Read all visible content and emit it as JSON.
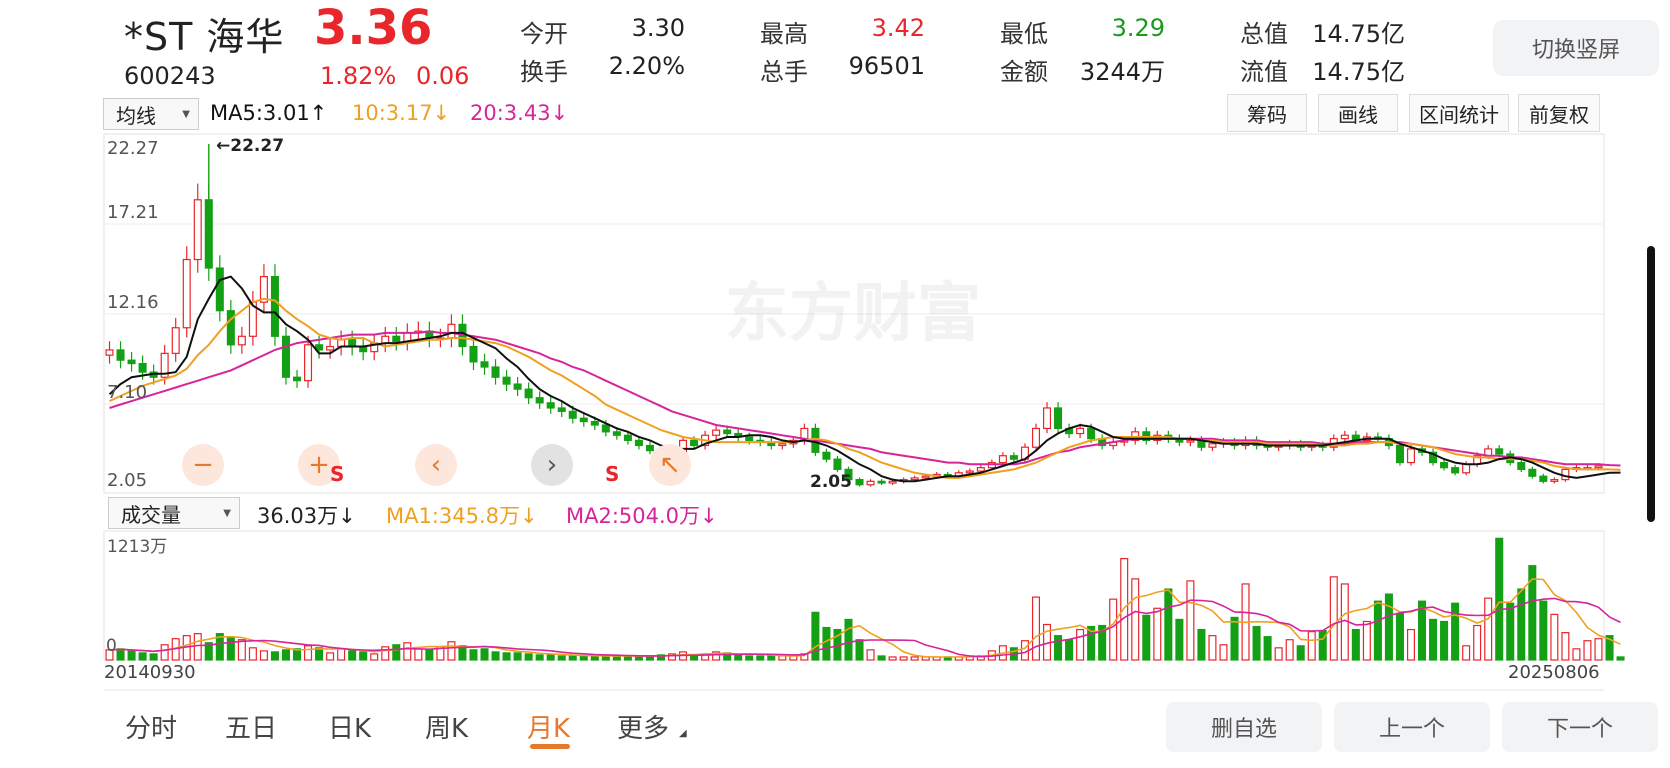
{
  "header": {
    "name": "*ST 海华",
    "price": "3.36",
    "code": "600243",
    "change_pct": "1.82%",
    "change": "0.06",
    "quotes": [
      {
        "label": "今开",
        "value": "3.30",
        "color": "#222"
      },
      {
        "label": "最高",
        "value": "3.42",
        "color": "#e8262b"
      },
      {
        "label": "最低",
        "value": "3.29",
        "color": "#1a9a1a"
      },
      {
        "label": "总值",
        "value": "14.75亿",
        "color": "#222"
      },
      {
        "label": "换手",
        "value": "2.20%",
        "color": "#222"
      },
      {
        "label": "总手",
        "value": "96501",
        "color": "#222"
      },
      {
        "label": "金额",
        "value": "3244万",
        "color": "#222"
      },
      {
        "label": "流值",
        "value": "14.75亿",
        "color": "#222"
      }
    ],
    "rotate_button": "切换竖屏"
  },
  "indicator_bar": {
    "select": "均线",
    "ma5": "MA5:3.01↑",
    "ma10": "10:3.17↓",
    "ma20": "20:3.43↓",
    "tools": [
      "筹码",
      "画线",
      "区间统计",
      "前复权"
    ],
    "colors": {
      "ma5": "#111111",
      "ma10": "#f0a020",
      "ma20": "#d6249a"
    }
  },
  "volume_bar": {
    "select": "成交量",
    "current": "36.03万↓",
    "ma1": "MA1:345.8万↓",
    "ma2": "MA2:504.0万↓",
    "ytop": "1213万",
    "ybottom": "0"
  },
  "watermark": "东方财富",
  "chart_data": {
    "type": "candlestick",
    "period": "monthly",
    "y_ticks": [
      "22.27",
      "17.21",
      "12.16",
      "7.10",
      "2.05"
    ],
    "ylim": [
      2.05,
      22.27
    ],
    "max_marker": "←22.27",
    "min_marker": "2.05",
    "x_start": "20140930",
    "x_end": "20250806",
    "close": [
      10.2,
      9.6,
      9.4,
      8.9,
      8.6,
      10.0,
      11.5,
      15.5,
      19.0,
      15.0,
      12.5,
      10.5,
      11.0,
      13.0,
      14.5,
      11.0,
      8.6,
      8.4,
      10.5,
      10.2,
      10.4,
      10.8,
      10.4,
      10.1,
      10.6,
      11.0,
      10.7,
      11.2,
      11.3,
      10.9,
      10.9,
      11.7,
      10.4,
      9.5,
      9.2,
      8.6,
      8.2,
      7.9,
      7.4,
      7.1,
      6.8,
      6.6,
      6.2,
      6.0,
      5.8,
      5.4,
      5.2,
      4.9,
      4.6,
      4.3,
      3.9,
      4.2,
      4.9,
      4.6,
      5.2,
      5.5,
      5.3,
      5.1,
      4.9,
      4.8,
      4.6,
      4.7,
      4.9,
      5.6,
      4.2,
      3.8,
      3.2,
      2.6,
      2.3,
      2.5,
      2.4,
      2.5,
      2.6,
      2.7,
      2.8,
      2.9,
      2.8,
      3.0,
      3.1,
      3.3,
      3.6,
      4.0,
      3.8,
      4.5,
      5.6,
      6.8,
      5.6,
      5.3,
      5.6,
      5.0,
      4.6,
      4.8,
      4.9,
      5.4,
      4.9,
      5.2,
      5.0,
      4.8,
      4.9,
      4.5,
      4.7,
      4.8,
      4.6,
      4.9,
      4.6,
      4.5,
      4.6,
      4.7,
      4.5,
      4.6,
      4.5,
      5.0,
      5.2,
      4.9,
      5.1,
      5.0,
      4.6,
      3.6,
      4.4,
      4.2,
      3.6,
      3.3,
      3.0,
      3.5,
      4.0,
      4.4,
      4.1,
      3.6,
      3.2,
      2.8,
      2.5,
      2.6,
      3.2,
      3.3,
      3.3,
      3.4
    ],
    "ma5": [
      7.6,
      8.2,
      8.6,
      8.7,
      8.8,
      8.8,
      8.9,
      9.8,
      12.0,
      13.2,
      14.3,
      14.5,
      13.8,
      12.8,
      12.4,
      12.4,
      11.7,
      11.3,
      10.8,
      10.0,
      10.0,
      10.4,
      10.4,
      10.4,
      10.5,
      10.6,
      10.6,
      10.7,
      10.8,
      10.9,
      11.0,
      11.2,
      11.2,
      10.9,
      10.6,
      10.3,
      9.7,
      9.2,
      8.5,
      7.9,
      7.5,
      7.2,
      6.8,
      6.5,
      6.2,
      5.9,
      5.6,
      5.4,
      5.1,
      4.9,
      4.6,
      4.4,
      4.4,
      4.4,
      4.7,
      4.9,
      5.1,
      5.1,
      5.2,
      5.2,
      5.1,
      4.9,
      4.8,
      4.9,
      4.8,
      4.6,
      4.3,
      3.9,
      3.5,
      3.2,
      2.8,
      2.6,
      2.5,
      2.5,
      2.6,
      2.7,
      2.8,
      2.8,
      2.9,
      3.0,
      3.2,
      3.4,
      3.6,
      3.8,
      4.3,
      4.9,
      5.3,
      5.6,
      5.8,
      5.7,
      5.4,
      5.1,
      5.0,
      5.0,
      5.0,
      5.0,
      5.0,
      5.0,
      5.0,
      4.9,
      4.8,
      4.7,
      4.7,
      4.7,
      4.7,
      4.6,
      4.6,
      4.6,
      4.6,
      4.6,
      4.6,
      4.7,
      4.8,
      4.9,
      5.0,
      5.0,
      5.0,
      4.7,
      4.5,
      4.3,
      4.1,
      3.8,
      3.6,
      3.5,
      3.5,
      3.6,
      3.8,
      3.9,
      3.8,
      3.6,
      3.3,
      3.0,
      2.8,
      2.7,
      2.8,
      2.9,
      3.0,
      3.01
    ],
    "ma10": [
      7.2,
      7.5,
      7.8,
      8.1,
      8.3,
      8.5,
      8.7,
      9.1,
      9.9,
      10.5,
      11.3,
      12.0,
      12.5,
      13.0,
      13.2,
      13.1,
      12.5,
      12.0,
      11.6,
      11.1,
      10.9,
      10.8,
      10.9,
      10.9,
      10.6,
      10.4,
      10.5,
      10.6,
      10.7,
      10.8,
      10.8,
      10.9,
      10.9,
      10.8,
      10.7,
      10.6,
      10.4,
      10.1,
      9.8,
      9.4,
      9.0,
      8.7,
      8.3,
      7.9,
      7.5,
      7.0,
      6.7,
      6.4,
      6.1,
      5.8,
      5.5,
      5.3,
      5.1,
      5.0,
      4.9,
      4.8,
      4.8,
      4.8,
      4.8,
      4.8,
      4.8,
      4.8,
      4.8,
      4.9,
      5.0,
      4.9,
      4.7,
      4.4,
      4.2,
      3.9,
      3.6,
      3.4,
      3.2,
      3.0,
      2.9,
      2.8,
      2.7,
      2.7,
      2.8,
      2.9,
      3.0,
      3.1,
      3.2,
      3.4,
      3.6,
      3.9,
      4.2,
      4.5,
      4.7,
      4.9,
      5.0,
      5.1,
      5.1,
      5.1,
      5.1,
      5.1,
      5.1,
      5.0,
      5.0,
      4.9,
      4.9,
      4.8,
      4.8,
      4.8,
      4.8,
      4.7,
      4.7,
      4.7,
      4.7,
      4.7,
      4.6,
      4.6,
      4.6,
      4.7,
      4.7,
      4.8,
      4.8,
      4.7,
      4.7,
      4.6,
      4.5,
      4.3,
      4.1,
      4.0,
      3.9,
      3.9,
      3.8,
      3.8,
      3.8,
      3.7,
      3.6,
      3.4,
      3.3,
      3.2,
      3.2,
      3.2,
      3.2,
      3.17
    ],
    "ma20": [
      6.8,
      7.0,
      7.2,
      7.4,
      7.6,
      7.8,
      8.0,
      8.2,
      8.4,
      8.6,
      8.8,
      9.0,
      9.3,
      9.6,
      9.9,
      10.2,
      10.4,
      10.6,
      10.7,
      10.8,
      10.9,
      11.0,
      11.1,
      11.1,
      11.1,
      11.2,
      11.2,
      11.2,
      11.2,
      11.3,
      11.2,
      11.2,
      11.1,
      11.0,
      10.9,
      10.8,
      10.6,
      10.4,
      10.2,
      10.0,
      9.7,
      9.5,
      9.2,
      9.0,
      8.7,
      8.4,
      8.1,
      7.8,
      7.5,
      7.2,
      6.9,
      6.6,
      6.4,
      6.2,
      6.0,
      5.8,
      5.7,
      5.6,
      5.5,
      5.4,
      5.3,
      5.2,
      5.1,
      5.0,
      4.9,
      4.8,
      4.7,
      4.6,
      4.5,
      4.4,
      4.2,
      4.1,
      4.0,
      3.9,
      3.8,
      3.7,
      3.6,
      3.6,
      3.5,
      3.5,
      3.5,
      3.5,
      3.5,
      3.6,
      3.8,
      4.0,
      4.2,
      4.3,
      4.5,
      4.6,
      4.7,
      4.8,
      4.9,
      5.0,
      5.0,
      5.0,
      5.0,
      5.0,
      5.0,
      5.0,
      5.0,
      4.9,
      4.9,
      4.9,
      4.9,
      4.8,
      4.8,
      4.8,
      4.8,
      4.8,
      4.7,
      4.7,
      4.7,
      4.8,
      4.8,
      4.8,
      4.8,
      4.8,
      4.7,
      4.6,
      4.5,
      4.4,
      4.3,
      4.2,
      4.1,
      4.0,
      4.0,
      3.9,
      3.9,
      3.8,
      3.7,
      3.6,
      3.5,
      3.5,
      3.5,
      3.5,
      3.45,
      3.43
    ],
    "volume_wan": [
      100,
      110,
      90,
      70,
      60,
      150,
      210,
      240,
      260,
      170,
      260,
      220,
      200,
      120,
      90,
      80,
      100,
      110,
      140,
      120,
      70,
      110,
      90,
      80,
      60,
      130,
      150,
      170,
      110,
      100,
      130,
      180,
      140,
      100,
      110,
      80,
      70,
      70,
      60,
      50,
      50,
      40,
      40,
      40,
      40,
      40,
      40,
      40,
      30,
      40,
      50,
      60,
      80,
      40,
      60,
      80,
      70,
      50,
      40,
      40,
      40,
      40,
      40,
      60,
      470,
      320,
      300,
      400,
      200,
      100,
      40,
      30,
      30,
      30,
      30,
      30,
      30,
      30,
      40,
      40,
      90,
      140,
      120,
      190,
      620,
      350,
      240,
      200,
      300,
      330,
      340,
      600,
      1000,
      800,
      440,
      510,
      700,
      400,
      780,
      300,
      240,
      150,
      420,
      750,
      330,
      230,
      120,
      200,
      140,
      280,
      290,
      820,
      750,
      300,
      380,
      580,
      650,
      460,
      300,
      580,
      400,
      380,
      560,
      140,
      340,
      610,
      1200,
      560,
      700,
      930,
      580,
      450,
      270,
      110,
      190,
      210,
      240,
      30
    ]
  }
}
